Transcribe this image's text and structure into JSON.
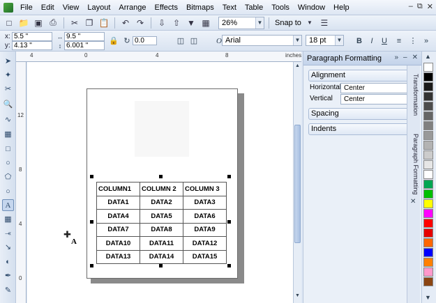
{
  "menu": [
    "File",
    "Edit",
    "View",
    "Layout",
    "Arrange",
    "Effects",
    "Bitmaps",
    "Text",
    "Table",
    "Tools",
    "Window",
    "Help"
  ],
  "toolbar": {
    "zoom": "26%",
    "snap_to": "Snap to"
  },
  "propbar": {
    "x_label": "x:",
    "x_value": "5.5 \"",
    "y_label": "y:",
    "y_value": "4.13 \"",
    "width_value": "9.5 \"",
    "height_value": "6.001 \"",
    "rotation_value": "0.0",
    "font_name": "Arial",
    "font_size": "18 pt"
  },
  "rulers": {
    "units": "inches",
    "h_ticks": [
      "4",
      "0",
      "4",
      "8"
    ],
    "v_ticks": [
      "12",
      "8",
      "4",
      "0"
    ]
  },
  "table": {
    "rows": [
      [
        "COLUMN1",
        "COLUMN 2",
        "COLUMN 3"
      ],
      [
        "DATA1",
        "DATA2",
        "DATA3"
      ],
      [
        "DATA4",
        "DATA5",
        "DATA6"
      ],
      [
        "DATA7",
        "DATA8",
        "DATA9"
      ],
      [
        "DATA10",
        "DATA11",
        "DATA12"
      ],
      [
        "DATA13",
        "DATA14",
        "DATA15"
      ]
    ]
  },
  "cursor_letter": "A",
  "docker": {
    "title": "Paragraph Formatting",
    "alignment": "Alignment",
    "horizontal_label": "Horizontal",
    "horizontal_value": "Center",
    "vertical_label": "Vertical",
    "vertical_value": "Center",
    "spacing": "Spacing",
    "indents": "Indents"
  },
  "side_tabs": [
    "Transformation",
    "Paragraph Formatting"
  ],
  "palette_colors": [
    "#ffffff",
    "#000000",
    "#1a1a1a",
    "#333333",
    "#4d4d4d",
    "#666666",
    "#808080",
    "#999999",
    "#b3b3b3",
    "#cccccc",
    "#e6e6e6",
    "#ffffff",
    "#00a651",
    "#00c000",
    "#ffff00",
    "#ff00ff",
    "#ff0000",
    "#e60000",
    "#ff6600",
    "#0000ff",
    "#ff8000",
    "#ff99cc",
    "#8b4513"
  ]
}
